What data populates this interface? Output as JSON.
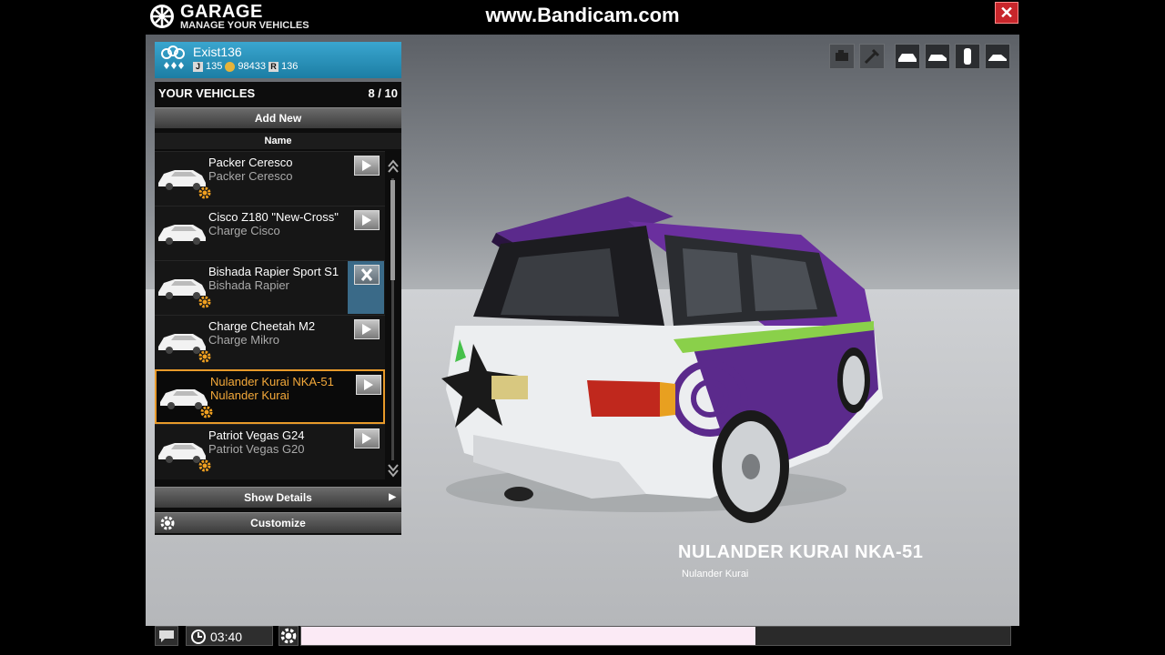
{
  "app": {
    "title": "GARAGE",
    "subtitle": "MANAGE YOUR VEHICLES",
    "watermark": "www.Bandicam.com",
    "close_icon": "close-icon"
  },
  "player": {
    "name": "Exist136",
    "level_badge": "J",
    "level": "135",
    "money": "98433",
    "rank_badge": "R",
    "rank": "136"
  },
  "vehicles_panel": {
    "header": "YOUR VEHICLES",
    "count": "8 / 10",
    "add_new_label": "Add New",
    "column_name": "Name",
    "items": [
      {
        "name": "Packer Ceresco",
        "model": "Packer Ceresco",
        "action": "arrow-right-icon",
        "gear": true,
        "selected": false
      },
      {
        "name": "Cisco Z180 \"New-Cross\"",
        "model": "Charge Cisco",
        "action": "arrow-right-icon",
        "gear": false,
        "selected": false
      },
      {
        "name": "Bishada Rapier Sport S1",
        "model": "Bishada Rapier",
        "action": "close-icon",
        "gear": true,
        "selected": false
      },
      {
        "name": "Charge Cheetah M2",
        "model": "Charge Mikro",
        "action": "arrow-right-icon",
        "gear": true,
        "selected": false
      },
      {
        "name": "Nulander Kurai NKA-51",
        "model": "Nulander Kurai",
        "action": "arrow-right-icon",
        "gear": true,
        "selected": true
      },
      {
        "name": "Patriot Vegas G24",
        "model": "Patriot Vegas G20",
        "action": "arrow-right-icon",
        "gear": true,
        "selected": false
      }
    ],
    "show_details_label": "Show Details",
    "customize_label": "Customize"
  },
  "view_controls": [
    "engine-icon",
    "tools-icon",
    "car-front-view-icon",
    "car-side-view-icon",
    "car-rear-view-icon",
    "car-top-view-icon"
  ],
  "selected_vehicle": {
    "title": "NULANDER KURAI NKA-51",
    "subtitle": "Nulander Kurai"
  },
  "bottom_bar": {
    "time": "03:40",
    "progress": 0.64
  },
  "colors": {
    "accent_blue": "#2a93bd",
    "selection_orange": "#e89a2a",
    "close_red": "#c8262b",
    "car_purple": "#5b2a8c"
  }
}
